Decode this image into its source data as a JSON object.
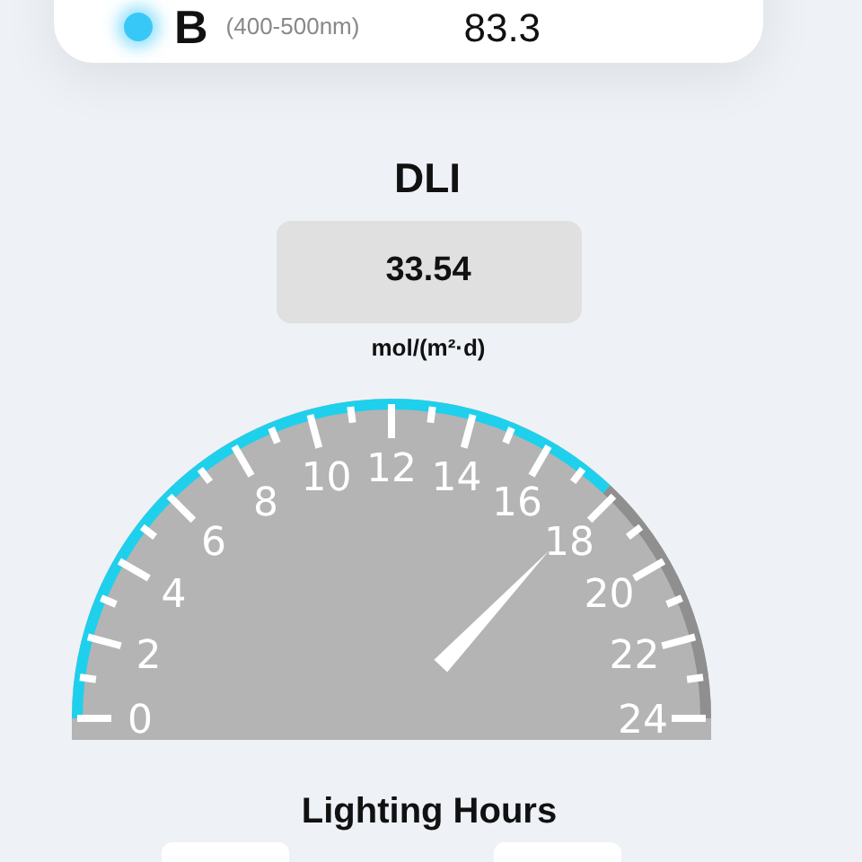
{
  "spectrum_card": {
    "rows": [
      {
        "band": "B",
        "range": "(400-500nm)",
        "value": "83.3",
        "color": "#38c8f8"
      }
    ]
  },
  "dli": {
    "title": "DLI",
    "value": "33.54",
    "unit": "mol/(m²·d)"
  },
  "gauge": {
    "labels": [
      "0",
      "2",
      "4",
      "6",
      "8",
      "10",
      "12",
      "14",
      "16",
      "18",
      "20",
      "22",
      "24"
    ]
  },
  "lighting_hours": {
    "title": "Lighting Hours"
  }
}
